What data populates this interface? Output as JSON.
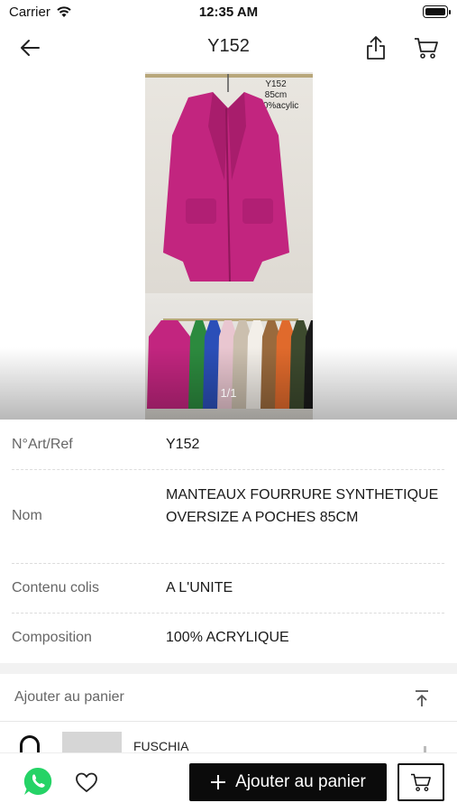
{
  "status_bar": {
    "carrier": "Carrier",
    "time": "12:35 AM"
  },
  "nav": {
    "title": "Y152"
  },
  "gallery": {
    "caption_lines": [
      "Y152",
      "85cm",
      "100%acylic"
    ],
    "pager": "1/1",
    "main_coat_color": "#c2257f",
    "palette": [
      "#c2257f",
      "#2c8a3e",
      "#2b4fb8",
      "#e9c6d0",
      "#cbbfae",
      "#f3efe9",
      "#9a6a3d",
      "#e06a2c",
      "#3d4a2e",
      "#1a1a1a"
    ]
  },
  "details": [
    {
      "label": "N°Art/Ref",
      "value": "Y152"
    },
    {
      "label": "Nom",
      "value": "MANTEAUX FOURRURE SYNTHETIQUE OVERSIZE A POCHES 85CM"
    },
    {
      "label": "Contenu colis",
      "value": "A L'UNITE"
    },
    {
      "label": "Composition",
      "value": "100% ACRYLIQUE"
    }
  ],
  "cart_section": {
    "title": "Ajouter au panier"
  },
  "variant": {
    "name": "FUSCHIA"
  },
  "actions": {
    "add_to_cart_label": "Ajouter au panier"
  },
  "colors": {
    "primary_button": "#0b0b0b",
    "whatsapp": "#25d366",
    "section_gap": "#f2f2f2"
  }
}
